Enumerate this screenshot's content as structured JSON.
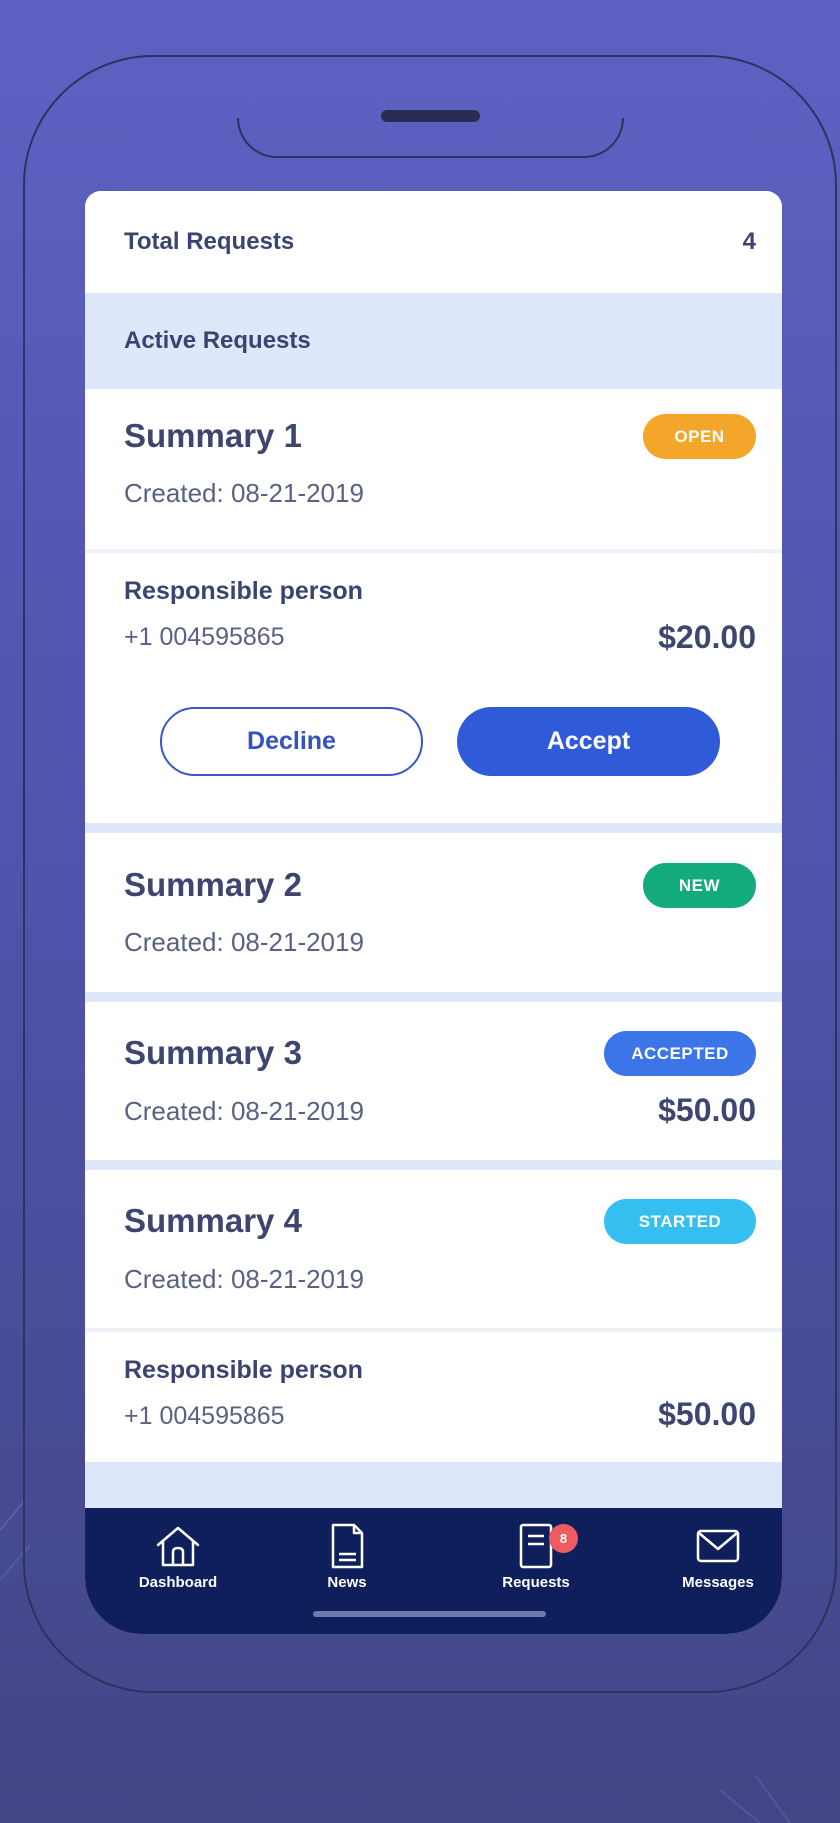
{
  "header": {
    "total_label": "Total Requests",
    "total_value": "4",
    "active_label": "Active Requests"
  },
  "requests": [
    {
      "title": "Summary 1",
      "created": "Created: 08-21-2019",
      "status": "OPEN",
      "status_color": "#f3a62a",
      "responsible_label": "Responsible person",
      "phone": "+1 004595865",
      "amount": "$20.00",
      "decline_label": "Decline",
      "accept_label": "Accept"
    },
    {
      "title": "Summary 2",
      "created": "Created: 08-21-2019",
      "status": "NEW",
      "status_color": "#13ab7d"
    },
    {
      "title": "Summary 3",
      "created": "Created: 08-21-2019",
      "status": "ACCEPTED",
      "status_color": "#3b75e8",
      "amount": "$50.00"
    },
    {
      "title": "Summary 4",
      "created": "Created: 08-21-2019",
      "status": "STARTED",
      "status_color": "#35bff0",
      "responsible_label": "Responsible person",
      "phone": "+1 004595865",
      "amount": "$50.00"
    }
  ],
  "nav": {
    "items": [
      {
        "label": "Dashboard",
        "icon": "home-icon"
      },
      {
        "label": "News",
        "icon": "document-icon"
      },
      {
        "label": "Requests",
        "icon": "list-icon",
        "badge": "8"
      },
      {
        "label": "Messages",
        "icon": "mail-icon"
      }
    ]
  }
}
